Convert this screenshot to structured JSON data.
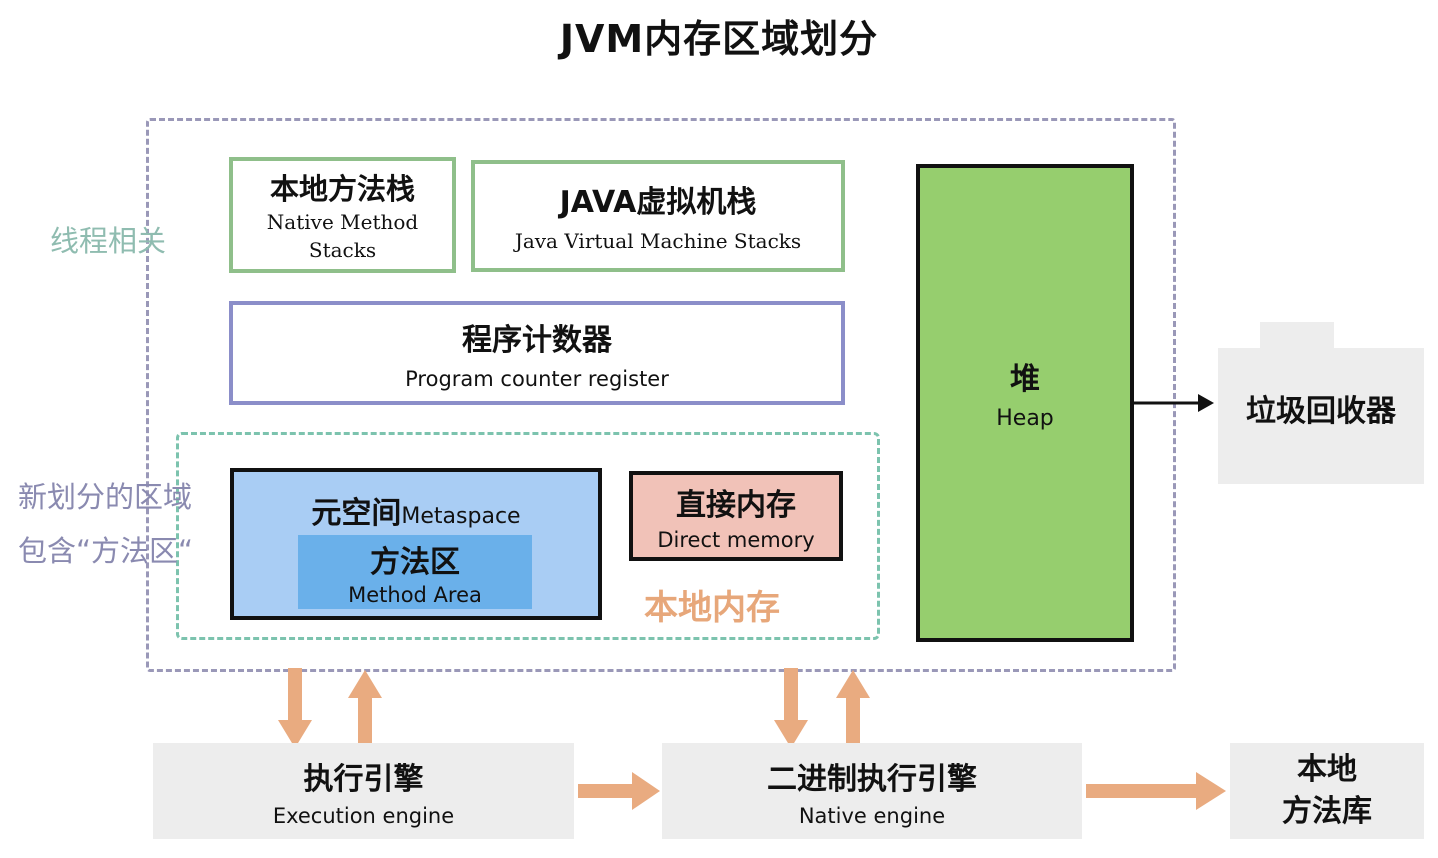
{
  "title": "JVM内存区域划分",
  "labels": {
    "thread_related": "线程相关",
    "new_area_line1": "新划分的区域",
    "new_area_line2": "包含“方法区“",
    "local_memory": "本地内存"
  },
  "boxes": {
    "native_stack": {
      "zh": "本地方法栈",
      "en_line1": "Native Method",
      "en_line2": "Stacks"
    },
    "jvm_stack": {
      "zh": "JAVA虚拟机栈",
      "en": "Java Virtual Machine Stacks"
    },
    "program_counter": {
      "zh": "程序计数器",
      "en": "Program counter register"
    },
    "heap": {
      "zh": "堆",
      "en": "Heap"
    },
    "metaspace": {
      "zh": "元空间",
      "en": "Metaspace"
    },
    "method_area": {
      "zh": "方法区",
      "en": "Method Area"
    },
    "direct_memory": {
      "zh": "直接内存",
      "en": "Direct memory"
    },
    "gc": {
      "zh": "垃圾回收器"
    },
    "execution_engine": {
      "zh": "执行引擎",
      "en": "Execution engine"
    },
    "native_engine": {
      "zh": "二进制执行引擎",
      "en": "Native engine"
    },
    "native_lib": {
      "zh_line1": "本地",
      "zh_line2": "方法库"
    }
  },
  "colors": {
    "heap_fill": "#96ce6e",
    "metaspace_fill": "#a9cdf4",
    "method_area_fill": "#6ab0ea",
    "direct_memory_fill": "#f1c2b8",
    "arrow_orange": "#e9ab80",
    "grey_box": "#ededed"
  }
}
